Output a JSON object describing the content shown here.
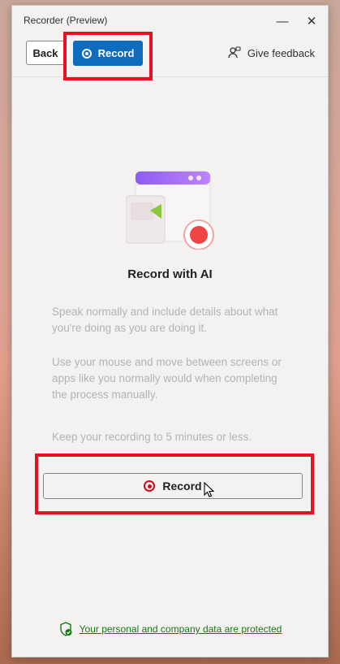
{
  "window": {
    "title": "Recorder (Preview)"
  },
  "toolbar": {
    "back_label": "Back",
    "record_label": "Record",
    "feedback_label": "Give feedback"
  },
  "main": {
    "heading": "Record with AI",
    "instructions": [
      "Speak normally and include details about what you're doing as you are doing it.",
      "Use your mouse and move between screens or apps like you normally would when completing the process manually.",
      "Keep your recording to 5 minutes or less."
    ],
    "record_button_label": "Record"
  },
  "footer": {
    "privacy_link": "Your personal and company data are protected"
  },
  "colors": {
    "accent": "#0f6cbd",
    "highlight": "#e81123",
    "record_red": "#c50f1f",
    "privacy_green": "#107c10"
  }
}
